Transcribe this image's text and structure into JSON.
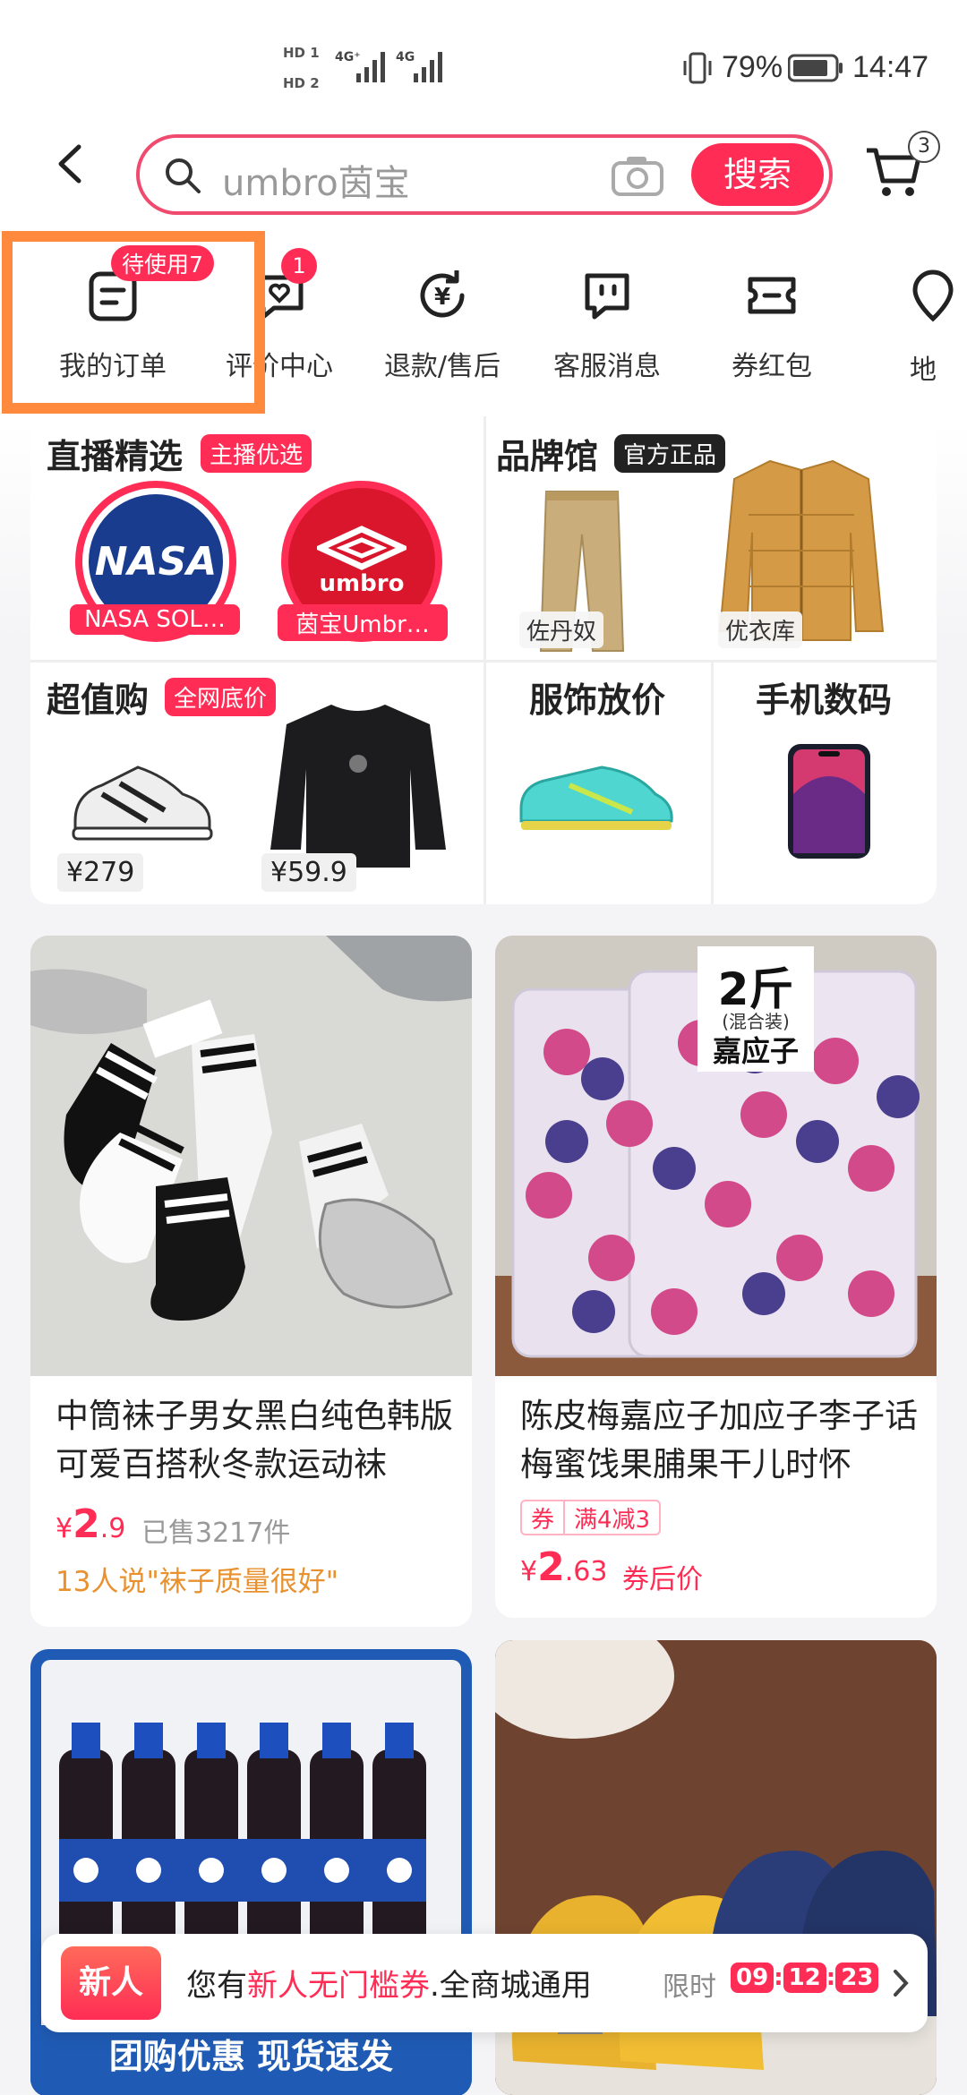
{
  "status_bar": {
    "hd1": "HD 1",
    "hd2": "HD 2",
    "net1": "4G⁺",
    "net2": "4G",
    "battery": "79%",
    "time": "14:47"
  },
  "header": {
    "search_placeholder": "umbro茵宝",
    "search_button": "搜索",
    "cart_count": "3"
  },
  "shortcuts": [
    {
      "label": "我的订单",
      "icon": "order-icon",
      "badge": "待使用7"
    },
    {
      "label": "评价中心",
      "icon": "review-icon",
      "badge": "1"
    },
    {
      "label": "退款/售后",
      "icon": "refund-icon"
    },
    {
      "label": "客服消息",
      "icon": "service-icon"
    },
    {
      "label": "券红包",
      "icon": "coupon-icon"
    },
    {
      "label": "地",
      "icon": "location-icon"
    }
  ],
  "promo": {
    "live": {
      "title": "直播精选",
      "tag": "主播优选",
      "items": [
        {
          "logo_text": "NASA",
          "name": "NASA SOL…"
        },
        {
          "logo_text": "umbro",
          "name": "茵宝Umbr…"
        }
      ]
    },
    "brand": {
      "title": "品牌馆",
      "tag": "官方正品",
      "items": [
        {
          "name": "佐丹奴"
        },
        {
          "name": "优衣库"
        }
      ]
    },
    "value": {
      "title": "超值购",
      "tag": "全网底价",
      "items": [
        {
          "price": "¥279"
        },
        {
          "price": "¥59.9"
        }
      ]
    },
    "apparel": {
      "title": "服饰放价"
    },
    "digital": {
      "title": "手机数码"
    }
  },
  "products": [
    {
      "title": "中筒袜子男女黑白纯色韩版可爱百搭秋冬款运动袜",
      "price_symbol": "¥",
      "price_int": "2",
      "price_dec": ".9",
      "sold": "已售3217件",
      "review": "13人说\"袜子质量很好\""
    },
    {
      "title": "陈皮梅嘉应子加应子李子话梅蜜饯果脯果干儿时怀",
      "coupon_tag": "券",
      "coupon_text": "满4减3",
      "price_symbol": "¥",
      "price_int": "2",
      "price_dec": ".63",
      "price_note": "券后价",
      "image_text": {
        "big": "2斤",
        "small": "(混合装)",
        "name": "嘉应子"
      }
    },
    {
      "banner_text": "团购优惠 现货速发"
    },
    {}
  ],
  "new_user_bar": {
    "badge": "新人",
    "text_prefix": "您有",
    "text_highlight": "新人无门槛券",
    "text_suffix": ".全商城通用",
    "limit_label": "限时",
    "countdown": [
      "09",
      "12",
      "23"
    ]
  },
  "colors": {
    "accent": "#ff2d55",
    "highlight_border": "#ff8a3d"
  }
}
